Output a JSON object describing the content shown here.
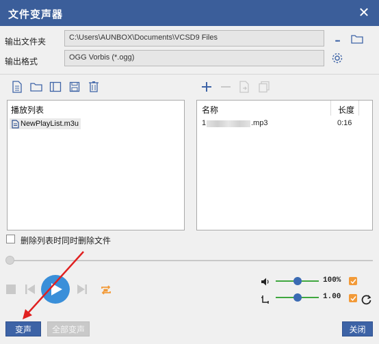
{
  "window": {
    "title": "文件变声器",
    "close_glyph": "✕"
  },
  "output": {
    "folder_label": "输出文件夹",
    "folder_value": "C:\\Users\\AUNBOX\\Documents\\VCSD9 Files",
    "format_label": "输出格式",
    "format_value": "OGG Vorbis (*.ogg)",
    "more_glyph": "•••"
  },
  "playlist": {
    "header": "播放列表",
    "items": [
      {
        "name": "NewPlayList.m3u"
      }
    ]
  },
  "filelist": {
    "col_name": "名称",
    "col_length": "长度",
    "rows": [
      {
        "name_prefix": "1",
        "name_suffix": ".mp3",
        "length": "0:16"
      }
    ]
  },
  "options": {
    "delete_files_label": "删除列表时同时删除文件"
  },
  "volume": {
    "value": "100%",
    "level": 0.5
  },
  "pitch": {
    "value": "1.00",
    "level": 0.5
  },
  "buttons": {
    "morph": "变声",
    "morph_all": "全部变声",
    "close": "关闭"
  },
  "colors": {
    "titlebar": "#3b5e9a",
    "accent": "#3d63a6",
    "orange": "#f29a38",
    "play": "#3a8fd9",
    "slider_green": "#3ea63e"
  }
}
